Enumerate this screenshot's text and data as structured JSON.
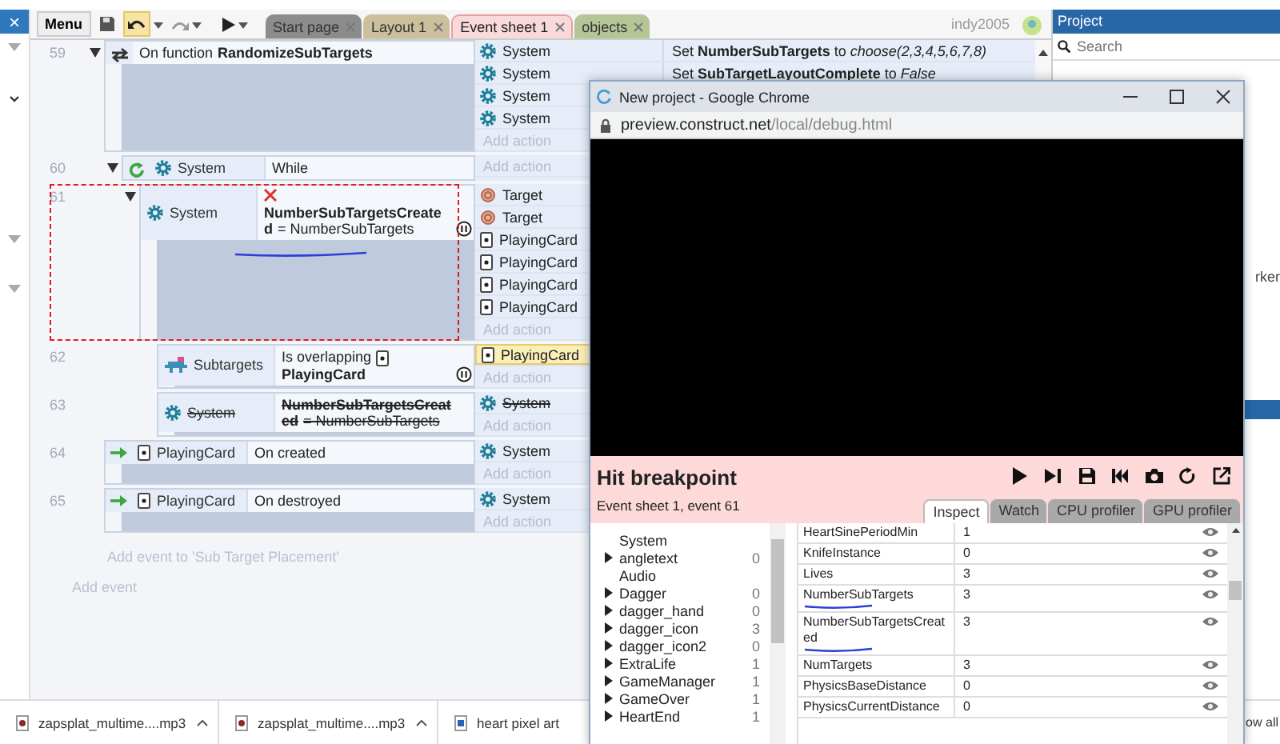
{
  "left_panel": {
    "close": "×"
  },
  "toolbar": {
    "menu": "Menu",
    "user": "indy2005",
    "tabs": [
      {
        "label": "Start page",
        "selected": false,
        "color": "#8c8c8c"
      },
      {
        "label": "Layout 1",
        "selected": false,
        "color": "#cbbf9c"
      },
      {
        "label": "Event sheet 1",
        "selected": true,
        "color": "#f9d9d9"
      },
      {
        "label": "objects",
        "selected": false,
        "color": "#b4c596"
      }
    ]
  },
  "events": [
    {
      "number": "59",
      "kind": "function",
      "expanded": true,
      "disabled": false,
      "marked": false,
      "conditions": [
        {
          "text": "On function",
          "param": "RandomizeSubTargets",
          "inverted": false,
          "breakpoint": false,
          "underlined": false
        }
      ],
      "actions": [
        {
          "object": "System",
          "kind": "system",
          "text": "Set **NumberSubTargets** to *choose(2,3,4,5,6,7,8)*",
          "highlighted": false
        },
        {
          "object": "System",
          "kind": "system",
          "text": "Set **SubTargetLayoutComplete** to *False*",
          "highlighted": false
        },
        {
          "object": "System",
          "kind": "system",
          "highlighted": false
        },
        {
          "object": "System",
          "kind": "system",
          "highlighted": false
        }
      ],
      "add_action": "Add action",
      "children": [
        {
          "number": "60",
          "kind": "loop",
          "expanded": true,
          "disabled": false,
          "marked": false,
          "conditions": [
            {
              "object": "System",
              "kind": "system",
              "text": "While",
              "inverted": false,
              "breakpoint": false,
              "underlined": false
            }
          ],
          "add_action": "Add action",
          "children": [
            {
              "number": "61",
              "expanded": true,
              "disabled": false,
              "marked": true,
              "conditions": [
                {
                  "object": "System",
                  "kind": "system",
                  "param": "NumberSubTargetsCreated",
                  "detail": "= NumberSubTargets",
                  "inverted": true,
                  "breakpoint": true,
                  "underlined": true
                }
              ],
              "actions": [
                {
                  "object": "Target",
                  "kind": "target",
                  "highlighted": false
                },
                {
                  "object": "Target",
                  "kind": "target",
                  "highlighted": false
                },
                {
                  "object": "PlayingCard",
                  "kind": "card",
                  "highlighted": false
                },
                {
                  "object": "PlayingCard",
                  "kind": "card",
                  "highlighted": false
                },
                {
                  "object": "PlayingCard",
                  "kind": "card",
                  "highlighted": false
                },
                {
                  "object": "PlayingCard",
                  "kind": "card",
                  "highlighted": false
                }
              ],
              "add_action": "Add action",
              "children": [
                {
                  "number": "62",
                  "disabled": false,
                  "marked": false,
                  "conditions": [
                    {
                      "object": "Subtargets",
                      "kind": "sprite",
                      "text": "Is overlapping",
                      "param": {
                        "kind": "card",
                        "text": "PlayingCard"
                      },
                      "inverted": false,
                      "breakpoint": true,
                      "underlined": false
                    }
                  ],
                  "actions": [
                    {
                      "object": "PlayingCard",
                      "kind": "card",
                      "highlighted": true
                    }
                  ],
                  "add_action": "Add action"
                },
                {
                  "number": "63",
                  "disabled": true,
                  "marked": false,
                  "conditions": [
                    {
                      "object": "System",
                      "kind": "system",
                      "param": "NumberSubTargetsCreated",
                      "detail": "= NumberSubTargets",
                      "inverted": false,
                      "breakpoint": false,
                      "underlined": false
                    }
                  ],
                  "actions": [
                    {
                      "object": "System",
                      "kind": "system",
                      "highlighted": false
                    }
                  ],
                  "add_action": "Add action"
                }
              ]
            }
          ]
        }
      ]
    },
    {
      "number": "64",
      "kind": "trigger",
      "disabled": false,
      "marked": false,
      "conditions": [
        {
          "object": "PlayingCard",
          "kind": "card",
          "text": "On created",
          "inverted": false,
          "breakpoint": false,
          "underlined": false
        }
      ],
      "actions": [
        {
          "object": "System",
          "kind": "system",
          "highlighted": false
        }
      ],
      "add_action": "Add action"
    },
    {
      "number": "65",
      "kind": "trigger",
      "disabled": false,
      "marked": false,
      "conditions": [
        {
          "object": "PlayingCard",
          "kind": "card",
          "text": "On destroyed",
          "inverted": false,
          "breakpoint": false,
          "underlined": false
        }
      ],
      "actions": [
        {
          "object": "System",
          "kind": "system",
          "highlighted": false
        }
      ],
      "add_action": "Add action"
    }
  ],
  "add_event_to": "Add event to 'Sub Target Placement'",
  "add_event": "Add event",
  "project": {
    "title": "Project",
    "search": {
      "placeholder": "Search"
    },
    "items": [
      "rker"
    ]
  },
  "downloads": {
    "items": [
      {
        "name": "zapsplat_multime....mp3",
        "kind": "audio"
      },
      {
        "name": "zapsplat_multime....mp3",
        "kind": "audio"
      },
      {
        "name": "heart pixel art",
        "kind": "image"
      }
    ],
    "show_all": "ow all"
  },
  "browser": {
    "title": "New project - Google Chrome",
    "host": "preview.construct.net",
    "path": "/local/debug.html",
    "debugger": {
      "title": "Hit breakpoint",
      "subtitle": "Event sheet 1, event 61",
      "tabs": [
        {
          "label": "Inspect",
          "selected": true
        },
        {
          "label": "Watch",
          "selected": false
        },
        {
          "label": "CPU profiler",
          "selected": false
        },
        {
          "label": "GPU profiler",
          "selected": false
        }
      ],
      "objects": [
        {
          "name": "System",
          "expandable": false
        },
        {
          "name": "angletext",
          "count": "0",
          "expandable": true
        },
        {
          "name": "Audio",
          "expandable": false
        },
        {
          "name": "Dagger",
          "count": "0",
          "expandable": true
        },
        {
          "name": "dagger_hand",
          "count": "0",
          "expandable": true
        },
        {
          "name": "dagger_icon",
          "count": "3",
          "expandable": true
        },
        {
          "name": "dagger_icon2",
          "count": "0",
          "expandable": true
        },
        {
          "name": "ExtraLife",
          "count": "1",
          "expandable": true
        },
        {
          "name": "GameManager",
          "count": "1",
          "expandable": true
        },
        {
          "name": "GameOver",
          "count": "1",
          "expandable": true
        },
        {
          "name": "HeartEnd",
          "count": "1",
          "expandable": true
        }
      ],
      "variables": [
        {
          "name": "HeartSinePeriodMin",
          "value": "1",
          "underlined": false
        },
        {
          "name": "KnifeInstance",
          "value": "0",
          "underlined": false
        },
        {
          "name": "Lives",
          "value": "3",
          "underlined": false
        },
        {
          "name": "NumberSubTargets",
          "value": "3",
          "underlined": true
        },
        {
          "name": "NumberSubTargetsCreated",
          "value": "3",
          "underlined": true
        },
        {
          "name": "NumTargets",
          "value": "3",
          "underlined": false
        },
        {
          "name": "PhysicsBaseDistance",
          "value": "0",
          "underlined": false
        },
        {
          "name": "PhysicsCurrentDistance",
          "value": "0",
          "underlined": false
        }
      ]
    }
  }
}
